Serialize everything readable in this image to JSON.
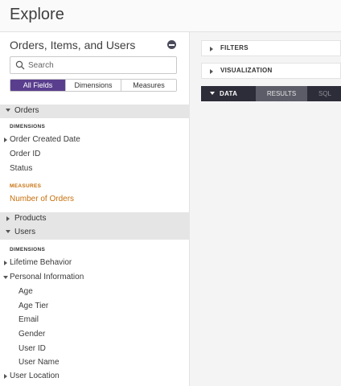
{
  "header": {
    "title": "Explore"
  },
  "sidebar": {
    "model_title": "Orders, Items, and Users",
    "search": {
      "placeholder": "Search"
    },
    "tabs": [
      {
        "label": "All Fields",
        "active": true
      },
      {
        "label": "Dimensions",
        "active": false
      },
      {
        "label": "Measures",
        "active": false
      }
    ],
    "orders": {
      "label": "Orders",
      "dimensions_label": "DIMENSIONS",
      "dimensions": [
        "Order Created Date",
        "Order ID",
        "Status"
      ],
      "measures_label": "MEASURES",
      "measures": [
        "Number of Orders"
      ]
    },
    "products": {
      "label": "Products"
    },
    "users": {
      "label": "Users",
      "dimensions_label": "DIMENSIONS",
      "lifetime_behavior": "Lifetime Behavior",
      "personal_information": "Personal Information",
      "personal_fields": [
        "Age",
        "Age Tier",
        "Email",
        "Gender",
        "User ID",
        "User Name"
      ],
      "user_location": "User Location"
    }
  },
  "main": {
    "filters_label": "FILTERS",
    "visualization_label": "VISUALIZATION",
    "data_tabs": {
      "data": "DATA",
      "results": "RESULTS",
      "sql": "SQL"
    }
  },
  "colors": {
    "accent": "#5a3e8e",
    "measure": "#c7700c",
    "data_bar": "#2d2d39"
  }
}
